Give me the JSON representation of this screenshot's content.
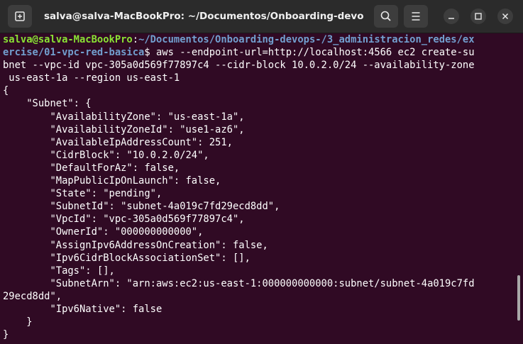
{
  "window": {
    "title": "salva@salva-MacBookPro: ~/Documentos/Onboarding-devop...",
    "buttons": {
      "new_tab_icon": "new-tab-icon",
      "search_icon": "search-icon",
      "menu_icon": "hamburger-menu-icon",
      "minimize_icon": "minimize-icon",
      "maximize_icon": "maximize-icon",
      "close_icon": "close-icon"
    }
  },
  "colors": {
    "background": "#300a24",
    "titlebar": "#2b2b2b",
    "prompt_user": "#8ae234",
    "prompt_path": "#729fcf",
    "text": "#ffffff"
  },
  "terminal": {
    "prompt": {
      "user": "salva@salva-MacBookPro",
      "sep": ":",
      "path_1": "~/Documentos/Onboarding-devops-/3_administracion_redes/ex",
      "path_2": "ercise/01-vpc-red-basica",
      "dollar": "$ ",
      "cmd_1": "aws --endpoint-url=http://localhost:4566 ec2 create-su",
      "cmd_2": "bnet --vpc-id vpc-305a0d569f77897c4 --cidr-block 10.0.2.0/24 --availability-zone",
      "cmd_3": " us-east-1a --region us-east-1"
    },
    "output": [
      "{",
      "    \"Subnet\": {",
      "        \"AvailabilityZone\": \"us-east-1a\",",
      "        \"AvailabilityZoneId\": \"use1-az6\",",
      "        \"AvailableIpAddressCount\": 251,",
      "        \"CidrBlock\": \"10.0.2.0/24\",",
      "        \"DefaultForAz\": false,",
      "        \"MapPublicIpOnLaunch\": false,",
      "        \"State\": \"pending\",",
      "        \"SubnetId\": \"subnet-4a019c7fd29ecd8dd\",",
      "        \"VpcId\": \"vpc-305a0d569f77897c4\",",
      "        \"OwnerId\": \"000000000000\",",
      "        \"AssignIpv6AddressOnCreation\": false,",
      "        \"Ipv6CidrBlockAssociationSet\": [],",
      "        \"Tags\": [],",
      "        \"SubnetArn\": \"arn:aws:ec2:us-east-1:000000000000:subnet/subnet-4a019c7fd",
      "29ecd8dd\",",
      "        \"Ipv6Native\": false",
      "    }",
      "}"
    ]
  }
}
